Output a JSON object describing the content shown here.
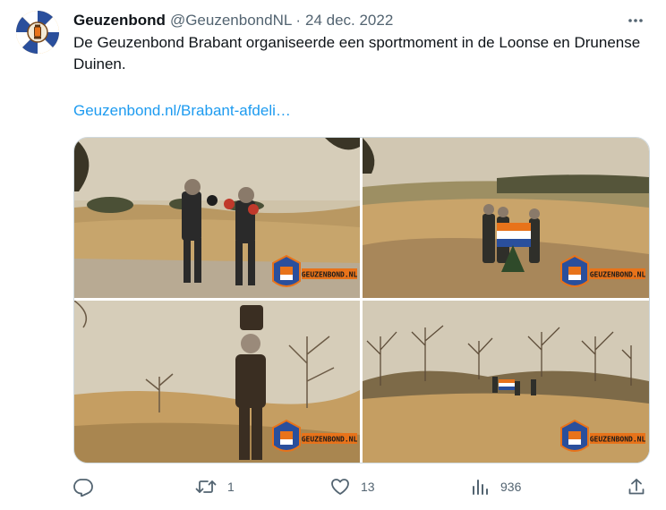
{
  "tweet": {
    "display_name": "Geuzenbond",
    "handle": "@GeuzenbondNL",
    "separator": "·",
    "date": "24 dec. 2022",
    "text": "De Geuzenbond Brabant organiseerde een sportmoment in de Loonse en Drunense Duinen.",
    "link": "Geuzenbond.nl/Brabant-afdeli…",
    "watermark": "GEUZENBOND.NL"
  },
  "actions": {
    "replies": "",
    "retweets": "1",
    "likes": "13",
    "views": "936"
  },
  "colors": {
    "accent": "#1d9bf0",
    "muted": "#536471",
    "text": "#0f1419",
    "sand": "#c9a46a",
    "sky": "#cfc6b4",
    "flag_orange": "#e8731a",
    "flag_blue": "#2a4f9c"
  },
  "icons": [
    "more-icon",
    "reply-icon",
    "retweet-icon",
    "like-icon",
    "views-icon",
    "share-icon"
  ]
}
